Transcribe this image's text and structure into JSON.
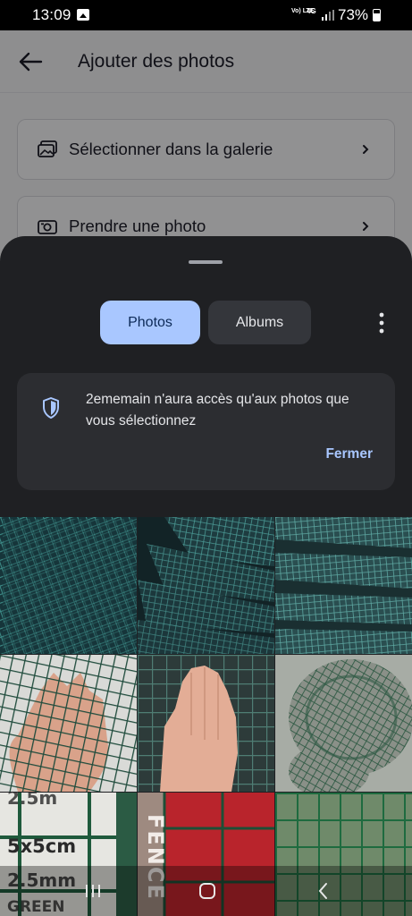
{
  "status_bar": {
    "time": "13:09",
    "network_volte": "Vo) LTE",
    "network_type": "4G",
    "battery": "73%"
  },
  "app": {
    "title": "Ajouter des photos",
    "options": [
      {
        "label": "Sélectionner dans la galerie",
        "icon": "gallery-icon"
      },
      {
        "label": "Prendre une photo",
        "icon": "camera-icon"
      }
    ]
  },
  "picker": {
    "tabs": [
      {
        "label": "Photos",
        "selected": true
      },
      {
        "label": "Albums",
        "selected": false
      }
    ],
    "notice": {
      "text": "2ememain n'aura accès qu'aux photos que vous sélectionnez",
      "close_label": "Fermer"
    },
    "photos": [
      {
        "caption": ""
      },
      {
        "caption": ""
      },
      {
        "caption": ""
      },
      {
        "caption": ""
      },
      {
        "caption": ""
      },
      {
        "caption": ""
      },
      {
        "caption_top": "2.5m",
        "caption": "5x5cm",
        "caption_mm": "2.5mm",
        "caption_green": "GREEN"
      },
      {
        "caption": "FENCE"
      },
      {
        "caption": ""
      }
    ]
  },
  "colors": {
    "accent": "#a9c7ff",
    "sheet_bg": "#1f2023",
    "card_bg": "#2c2d31",
    "mesh_green": "#2f6f66"
  }
}
